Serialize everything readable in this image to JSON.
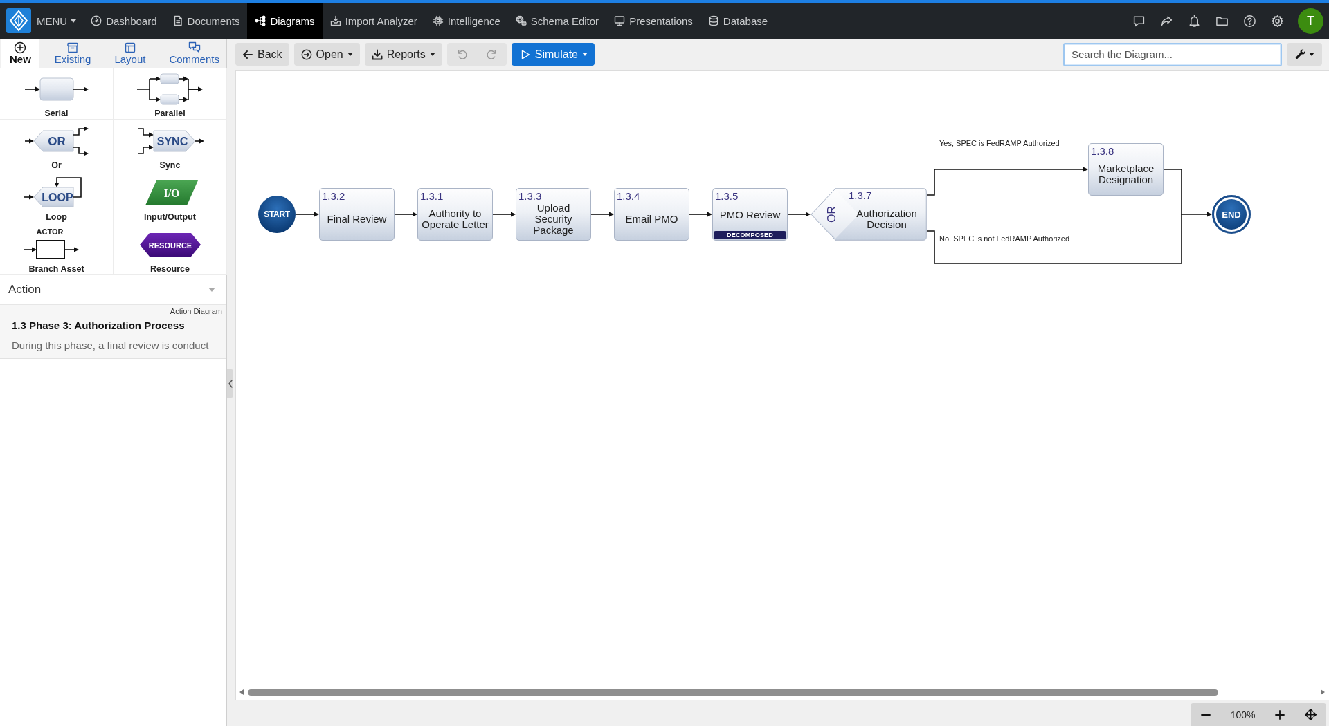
{
  "nav": {
    "menu": "MENU",
    "tabs": [
      {
        "label": "Dashboard",
        "selected": false
      },
      {
        "label": "Documents",
        "selected": false
      },
      {
        "label": "Diagrams",
        "selected": true
      },
      {
        "label": "Import Analyzer",
        "selected": false
      },
      {
        "label": "Intelligence",
        "selected": false
      },
      {
        "label": "Schema Editor",
        "selected": false
      },
      {
        "label": "Presentations",
        "selected": false
      },
      {
        "label": "Database",
        "selected": false
      }
    ],
    "user_initial": "T"
  },
  "panel": {
    "tabs": [
      {
        "label": "New",
        "selected": true
      },
      {
        "label": "Existing",
        "selected": false
      },
      {
        "label": "Layout",
        "selected": false
      },
      {
        "label": "Comments",
        "selected": false
      }
    ],
    "palette": [
      {
        "kind": "serial",
        "label": "Serial"
      },
      {
        "kind": "parallel",
        "label": "Parallel"
      },
      {
        "kind": "or",
        "label": "Or",
        "symbol_text": "OR"
      },
      {
        "kind": "sync",
        "label": "Sync",
        "symbol_text": "SYNC"
      },
      {
        "kind": "loop",
        "label": "Loop",
        "symbol_text": "LOOP"
      },
      {
        "kind": "io",
        "label": "Input/Output",
        "symbol_text": "I/O"
      },
      {
        "kind": "branch_asset",
        "label": "Branch Asset",
        "symbol_text": "ACTOR"
      },
      {
        "kind": "resource",
        "label": "Resource",
        "symbol_text": "RESOURCE"
      }
    ],
    "type_select": {
      "value": "Action"
    },
    "details": {
      "type": "Action Diagram",
      "title": "1.3 Phase 3: Authorization Process",
      "description": "During this phase, a final review is conduct"
    }
  },
  "toolbar": {
    "buttons": [
      {
        "kind": "back",
        "label": "Back",
        "dropdown": false
      },
      {
        "kind": "open",
        "label": "Open",
        "dropdown": true
      },
      {
        "kind": "reports",
        "label": "Reports",
        "dropdown": true
      }
    ],
    "history": [
      {
        "kind": "undo",
        "disabled": true
      },
      {
        "kind": "redo",
        "disabled": true
      }
    ],
    "simulate": {
      "label": "Simulate",
      "dropdown": true
    },
    "search": {
      "placeholder": "Search the Diagram...",
      "focused": true
    }
  },
  "diagram": {
    "start": {
      "label": "START"
    },
    "steps": [
      {
        "kind": "action",
        "number": "1.3.2",
        "label": "Final Review"
      },
      {
        "kind": "action",
        "number": "1.3.1",
        "label": "Authority to Operate Letter"
      },
      {
        "kind": "action",
        "number": "1.3.3",
        "label": "Upload Security Package"
      },
      {
        "kind": "action",
        "number": "1.3.4",
        "label": "Email PMO"
      },
      {
        "kind": "action",
        "number": "1.3.5",
        "label": "PMO Review",
        "badge": "DECOMPOSED"
      },
      {
        "kind": "decision",
        "number": "1.3.7",
        "label": "Authorization Decision",
        "gate": "OR"
      }
    ],
    "branches": [
      {
        "label": "Yes, SPEC is FedRAMP Authorized",
        "target": {
          "number": "1.3.8",
          "label": "Marketplace Designation"
        }
      },
      {
        "label": "No, SPEC is not FedRAMP Authorized"
      }
    ],
    "end": {
      "label": "END"
    }
  },
  "zoom": {
    "reading": "100%"
  }
}
